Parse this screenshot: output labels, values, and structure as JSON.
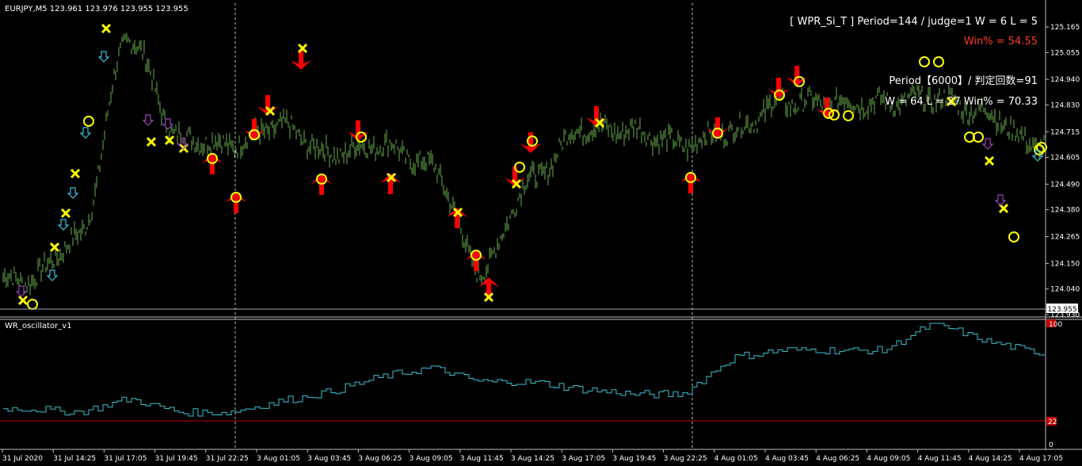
{
  "main_chart": {
    "symbol_header": "EURJPY,M5  123.961 123.976 123.955 123.955",
    "info_line1": "[ WPR_Si_T ]  Period=144 / judge=1  W = 6 L = 5",
    "info_line2": "Win% = 54.55",
    "info_line3": "Period【6000】/ 判定回数=91",
    "info_line4": "W = 64  L = 27  Win% = 70.33",
    "current_price": "123.955",
    "price_ticks": [
      "125.165",
      "125.055",
      "124.940",
      "124.830",
      "124.715",
      "124.605",
      "124.490",
      "124.380",
      "124.265",
      "124.150",
      "124.040",
      "123.930"
    ]
  },
  "oscillator": {
    "title": "WR_oscillator_v1",
    "scale_labels": [
      "100",
      "0"
    ],
    "level_label": "22"
  },
  "time_axis": {
    "labels": [
      "31 Jul 2020",
      "31 Jul 14:25",
      "31 Jul 17:05",
      "31 Jul 19:45",
      "31 Jul 22:25",
      "3 Aug 01:05",
      "3 Aug 03:45",
      "3 Aug 06:25",
      "3 Aug 09:05",
      "3 Aug 11:45",
      "3 Aug 14:25",
      "3 Aug 17:05",
      "3 Aug 19:45",
      "3 Aug 22:25",
      "4 Aug 01:05",
      "4 Aug 03:45",
      "4 Aug 06:25",
      "4 Aug 09:05",
      "4 Aug 11:45",
      "4 Aug 14:25",
      "4 Aug 17:05"
    ]
  },
  "colors": {
    "background": "#000000",
    "candles": "#6ab04c",
    "axis_text": "#ffffff",
    "win_text": "#ff3c28",
    "oscillator_line": "#38c0d0",
    "oscillator_level": "#c00000",
    "separator": "#c0c0c0",
    "signal_arrow": "#ff0000",
    "cross_marker": "#ffff00",
    "circle_marker": "#ffff00",
    "hint_arrow_cyan": "#40c0e0",
    "hint_arrow_purple": "#a040c0"
  },
  "chart_data": [
    {
      "type": "line",
      "name": "EURJPY M5 price",
      "ylim": [
        123.93,
        125.165
      ],
      "x": [
        "31 Jul 2020",
        "31 Jul 14:25",
        "31 Jul 17:05",
        "31 Jul 19:45",
        "31 Jul 22:25",
        "3 Aug 01:05",
        "3 Aug 03:45",
        "3 Aug 06:25",
        "3 Aug 09:05",
        "3 Aug 11:45",
        "3 Aug 14:25",
        "3 Aug 17:05",
        "3 Aug 19:45",
        "3 Aug 22:25",
        "4 Aug 01:05",
        "4 Aug 03:45",
        "4 Aug 06:25",
        "4 Aug 09:05",
        "4 Aug 11:45",
        "4 Aug 14:25",
        "4 Aug 17:05"
      ],
      "values": [
        124.08,
        124.26,
        125.12,
        124.69,
        124.66,
        124.74,
        124.62,
        124.66,
        124.57,
        124.12,
        124.51,
        124.73,
        124.72,
        124.66,
        124.72,
        124.84,
        124.84,
        124.84,
        124.86,
        124.8,
        124.66
      ]
    },
    {
      "type": "line",
      "name": "WR oscillator",
      "ylim": [
        0,
        100
      ],
      "level": 22,
      "x": [
        "31 Jul 2020",
        "31 Jul 14:25",
        "31 Jul 17:05",
        "31 Jul 19:45",
        "31 Jul 22:25",
        "3 Aug 01:05",
        "3 Aug 03:45",
        "3 Aug 06:25",
        "3 Aug 09:05",
        "3 Aug 11:45",
        "3 Aug 14:25",
        "3 Aug 17:05",
        "3 Aug 19:45",
        "3 Aug 22:25",
        "4 Aug 01:05",
        "4 Aug 03:45",
        "4 Aug 06:25",
        "4 Aug 09:05",
        "4 Aug 11:45",
        "4 Aug 14:25",
        "4 Aug 17:05"
      ],
      "values": [
        30,
        27,
        38,
        27,
        27,
        36,
        44,
        56,
        64,
        52,
        52,
        46,
        42,
        42,
        72,
        78,
        78,
        78,
        100,
        86,
        76
      ]
    }
  ]
}
